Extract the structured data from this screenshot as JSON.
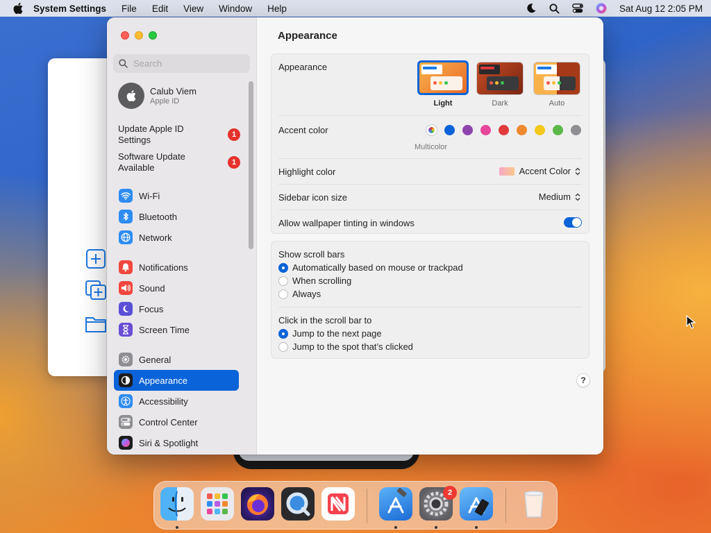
{
  "menubar": {
    "app_name": "System Settings",
    "menus": [
      "File",
      "Edit",
      "View",
      "Window",
      "Help"
    ],
    "status_icons": [
      "moon-icon",
      "search-icon",
      "control-center-icon",
      "siri-icon"
    ],
    "datetime": "Sat Aug 12  2:05 PM"
  },
  "sidebar": {
    "search_placeholder": "Search",
    "profile": {
      "name": "Calub Viem",
      "subtitle": "Apple ID"
    },
    "notices": [
      {
        "text": "Update Apple ID Settings",
        "badge": "1"
      },
      {
        "text": "Software Update Available",
        "badge": "1"
      }
    ],
    "items": [
      {
        "label": "Wi-Fi",
        "icon": "wifi-icon",
        "color": "#2e8cf2"
      },
      {
        "label": "Bluetooth",
        "icon": "bluetooth-icon",
        "color": "#2e8cf2"
      },
      {
        "label": "Network",
        "icon": "globe-icon",
        "color": "#2e8cf2"
      },
      {
        "label": "Notifications",
        "icon": "bell-icon",
        "color": "#f0483f"
      },
      {
        "label": "Sound",
        "icon": "speaker-icon",
        "color": "#f0483f"
      },
      {
        "label": "Focus",
        "icon": "moon-icon",
        "color": "#5a4fd6"
      },
      {
        "label": "Screen Time",
        "icon": "hourglass-icon",
        "color": "#6b4ed6"
      },
      {
        "label": "General",
        "icon": "gear-icon",
        "color": "#8e8e93"
      },
      {
        "label": "Appearance",
        "icon": "appearance-icon",
        "color": "#1c1c1e"
      },
      {
        "label": "Accessibility",
        "icon": "accessibility-icon",
        "color": "#2e8cf2"
      },
      {
        "label": "Control Center",
        "icon": "toggles-icon",
        "color": "#8e8e93"
      },
      {
        "label": "Siri & Spotlight",
        "icon": "siri-icon",
        "color": "#1c1c1e"
      }
    ],
    "selected": "Appearance"
  },
  "content": {
    "title": "Appearance",
    "appearance": {
      "label": "Appearance",
      "options": [
        "Light",
        "Dark",
        "Auto"
      ],
      "selected": "Light"
    },
    "accent": {
      "label": "Accent color",
      "colors": [
        "#0a63d8",
        "#8e44ad",
        "#e6479a",
        "#e03a3a",
        "#f0892e",
        "#f4c81c",
        "#5cb84a",
        "#8e8e93"
      ],
      "multicolor_label": "Multicolor"
    },
    "highlight": {
      "label": "Highlight color",
      "value": "Accent Color"
    },
    "icon_size": {
      "label": "Sidebar icon size",
      "value": "Medium"
    },
    "tinting": {
      "label": "Allow wallpaper tinting in windows",
      "enabled": true
    },
    "scrollbars": {
      "label": "Show scroll bars",
      "options": [
        "Automatically based on mouse or trackpad",
        "When scrolling",
        "Always"
      ],
      "selected": 0
    },
    "click_scroll": {
      "label": "Click in the scroll bar to",
      "options": [
        "Jump to the next page",
        "Jump to the spot that’s clicked"
      ],
      "selected": 0
    },
    "help": "?"
  },
  "dock": {
    "apps": [
      "Finder",
      "Launchpad",
      "Firefox",
      "QuickTime Player",
      "News",
      "Xcode",
      "System Settings",
      "Instruments",
      "Trash"
    ],
    "settings_badge": "2"
  }
}
